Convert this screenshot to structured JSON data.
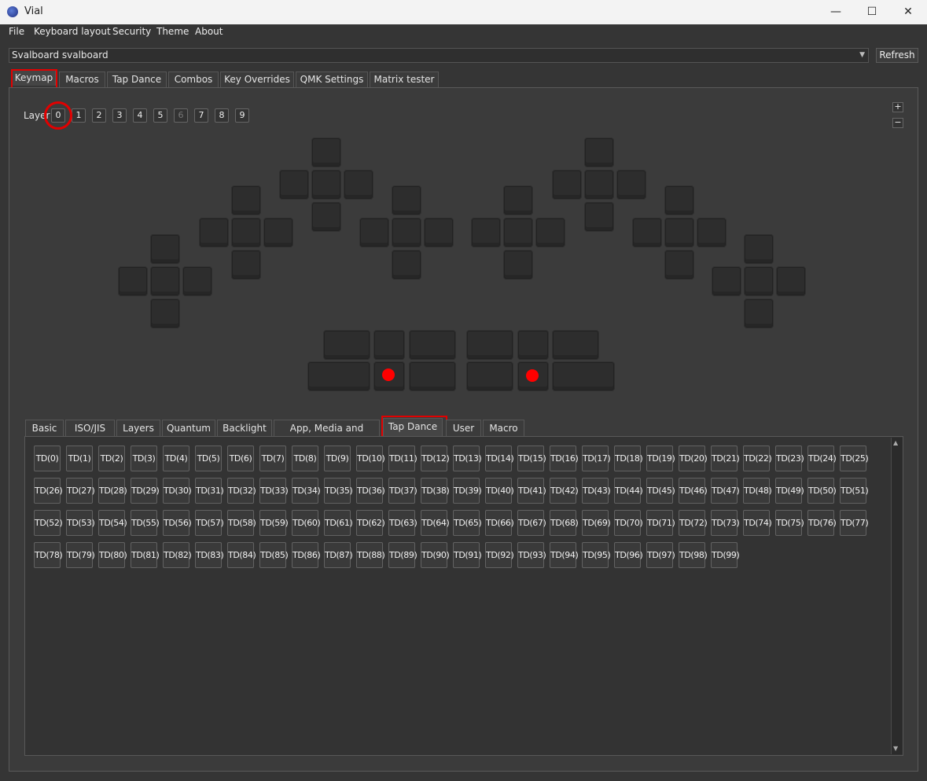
{
  "window": {
    "title": "Vial",
    "minimize_glyph": "—",
    "maximize_glyph": "☐",
    "close_glyph": "✕"
  },
  "menu": [
    "File",
    "Keyboard layout",
    "Security",
    "Theme",
    "About"
  ],
  "device": {
    "selected": "Svalboard svalboard",
    "refresh_label": "Refresh"
  },
  "main_tabs": [
    "Keymap",
    "Macros",
    "Tap Dance",
    "Combos",
    "Key Overrides",
    "QMK Settings",
    "Matrix tester"
  ],
  "active_main_tab": "Keymap",
  "layers": {
    "label": "Layer",
    "buttons": [
      "0",
      "1",
      "2",
      "3",
      "4",
      "5",
      "6",
      "7",
      "8",
      "9"
    ],
    "selected": "0",
    "zoom_in": "+",
    "zoom_out": "−"
  },
  "keycode_tabs": [
    "Basic",
    "ISO/JIS",
    "Layers",
    "Quantum",
    "Backlight",
    "App, Media and Mouse",
    "Tap Dance",
    "User",
    "Macro"
  ],
  "active_keycode_tab": "Tap Dance",
  "tap_dance_keys": [
    "TD(0)",
    "TD(1)",
    "TD(2)",
    "TD(3)",
    "TD(4)",
    "TD(5)",
    "TD(6)",
    "TD(7)",
    "TD(8)",
    "TD(9)",
    "TD(10)",
    "TD(11)",
    "TD(12)",
    "TD(13)",
    "TD(14)",
    "TD(15)",
    "TD(16)",
    "TD(17)",
    "TD(18)",
    "TD(19)",
    "TD(20)",
    "TD(21)",
    "TD(22)",
    "TD(23)",
    "TD(24)",
    "TD(25)",
    "TD(26)",
    "TD(27)",
    "TD(28)",
    "TD(29)",
    "TD(30)",
    "TD(31)",
    "TD(32)",
    "TD(33)",
    "TD(34)",
    "TD(35)",
    "TD(36)",
    "TD(37)",
    "TD(38)",
    "TD(39)",
    "TD(40)",
    "TD(41)",
    "TD(42)",
    "TD(43)",
    "TD(44)",
    "TD(45)",
    "TD(46)",
    "TD(47)",
    "TD(48)",
    "TD(49)",
    "TD(50)",
    "TD(51)",
    "TD(52)",
    "TD(53)",
    "TD(54)",
    "TD(55)",
    "TD(56)",
    "TD(57)",
    "TD(58)",
    "TD(59)",
    "TD(60)",
    "TD(61)",
    "TD(62)",
    "TD(63)",
    "TD(64)",
    "TD(65)",
    "TD(66)",
    "TD(67)",
    "TD(68)",
    "TD(69)",
    "TD(70)",
    "TD(71)",
    "TD(72)",
    "TD(73)",
    "TD(74)",
    "TD(75)",
    "TD(76)",
    "TD(77)",
    "TD(78)",
    "TD(79)",
    "TD(80)",
    "TD(81)",
    "TD(82)",
    "TD(83)",
    "TD(84)",
    "TD(85)",
    "TD(86)",
    "TD(87)",
    "TD(88)",
    "TD(89)",
    "TD(90)",
    "TD(91)",
    "TD(92)",
    "TD(93)",
    "TD(94)",
    "TD(95)",
    "TD(96)",
    "TD(97)",
    "TD(98)",
    "TD(99)"
  ],
  "colors": {
    "highlight": "#e20000",
    "background": "#353535"
  }
}
